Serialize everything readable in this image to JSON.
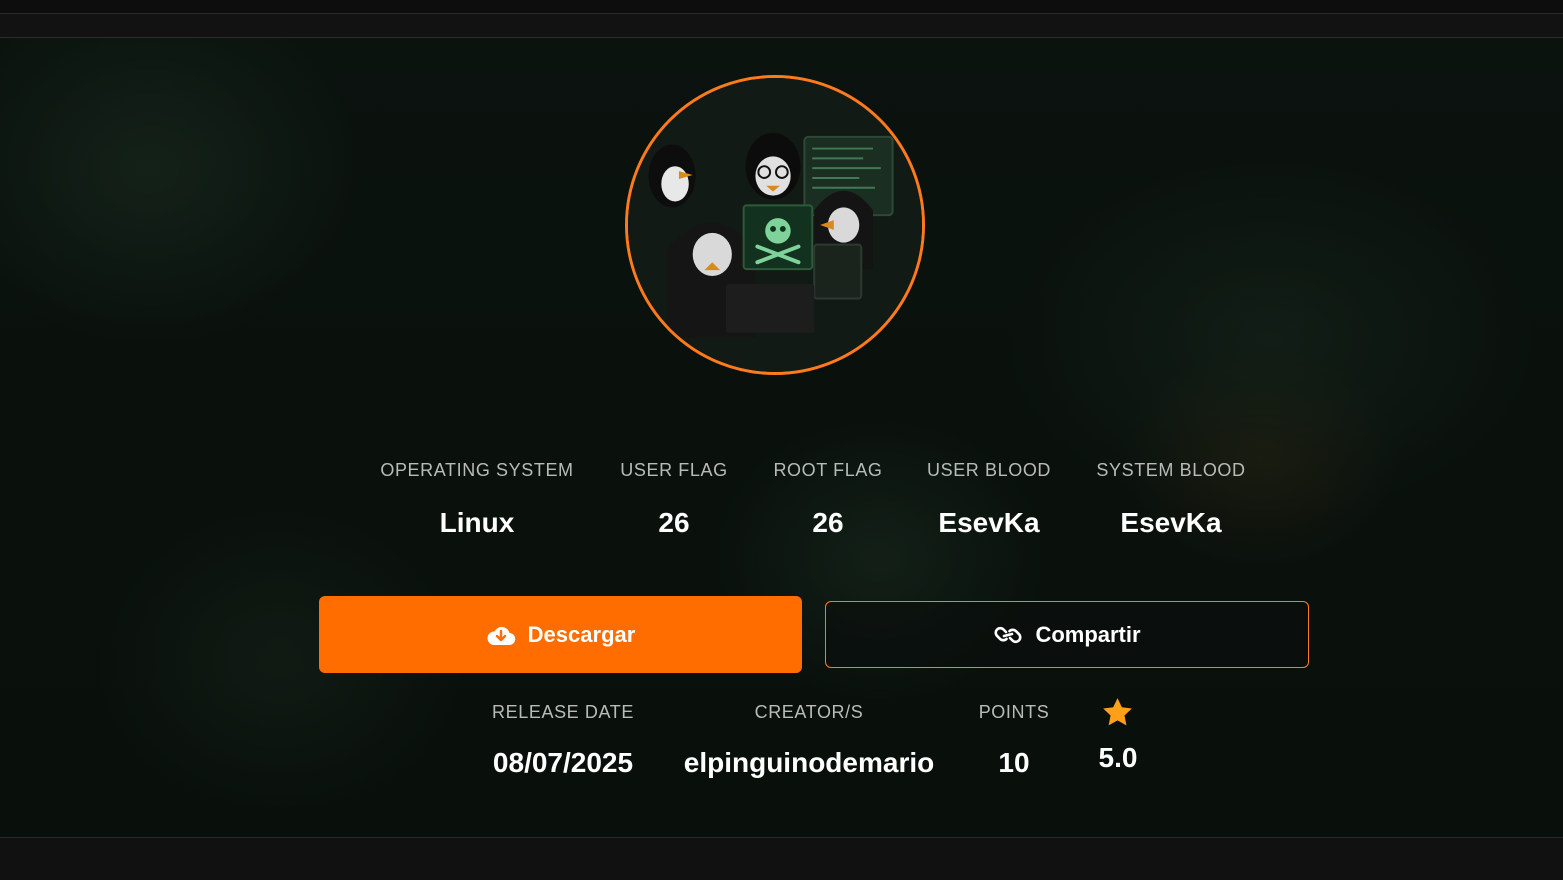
{
  "stats": [
    {
      "label": "OPERATING SYSTEM",
      "value": "Linux"
    },
    {
      "label": "USER FLAG",
      "value": "26"
    },
    {
      "label": "ROOT FLAG",
      "value": "26"
    },
    {
      "label": "USER BLOOD",
      "value": "EsevKa"
    },
    {
      "label": "SYSTEM BLOOD",
      "value": "EsevKa"
    }
  ],
  "actions": {
    "download_label": "Descargar",
    "share_label": "Compartir"
  },
  "meta": {
    "release_label": "RELEASE DATE",
    "release_value": "08/07/2025",
    "creator_label": "CREATOR/S",
    "creator_value": "elpinguinodemario",
    "points_label": "POINTS",
    "points_value": "10",
    "rating_value": "5.0"
  },
  "icons": {
    "download": "cloud-download-icon",
    "share": "link-icon",
    "rating": "star-icon"
  },
  "colors": {
    "accent": "#ff6d00",
    "star": "#ff9f1a",
    "background": "#0e1712"
  }
}
